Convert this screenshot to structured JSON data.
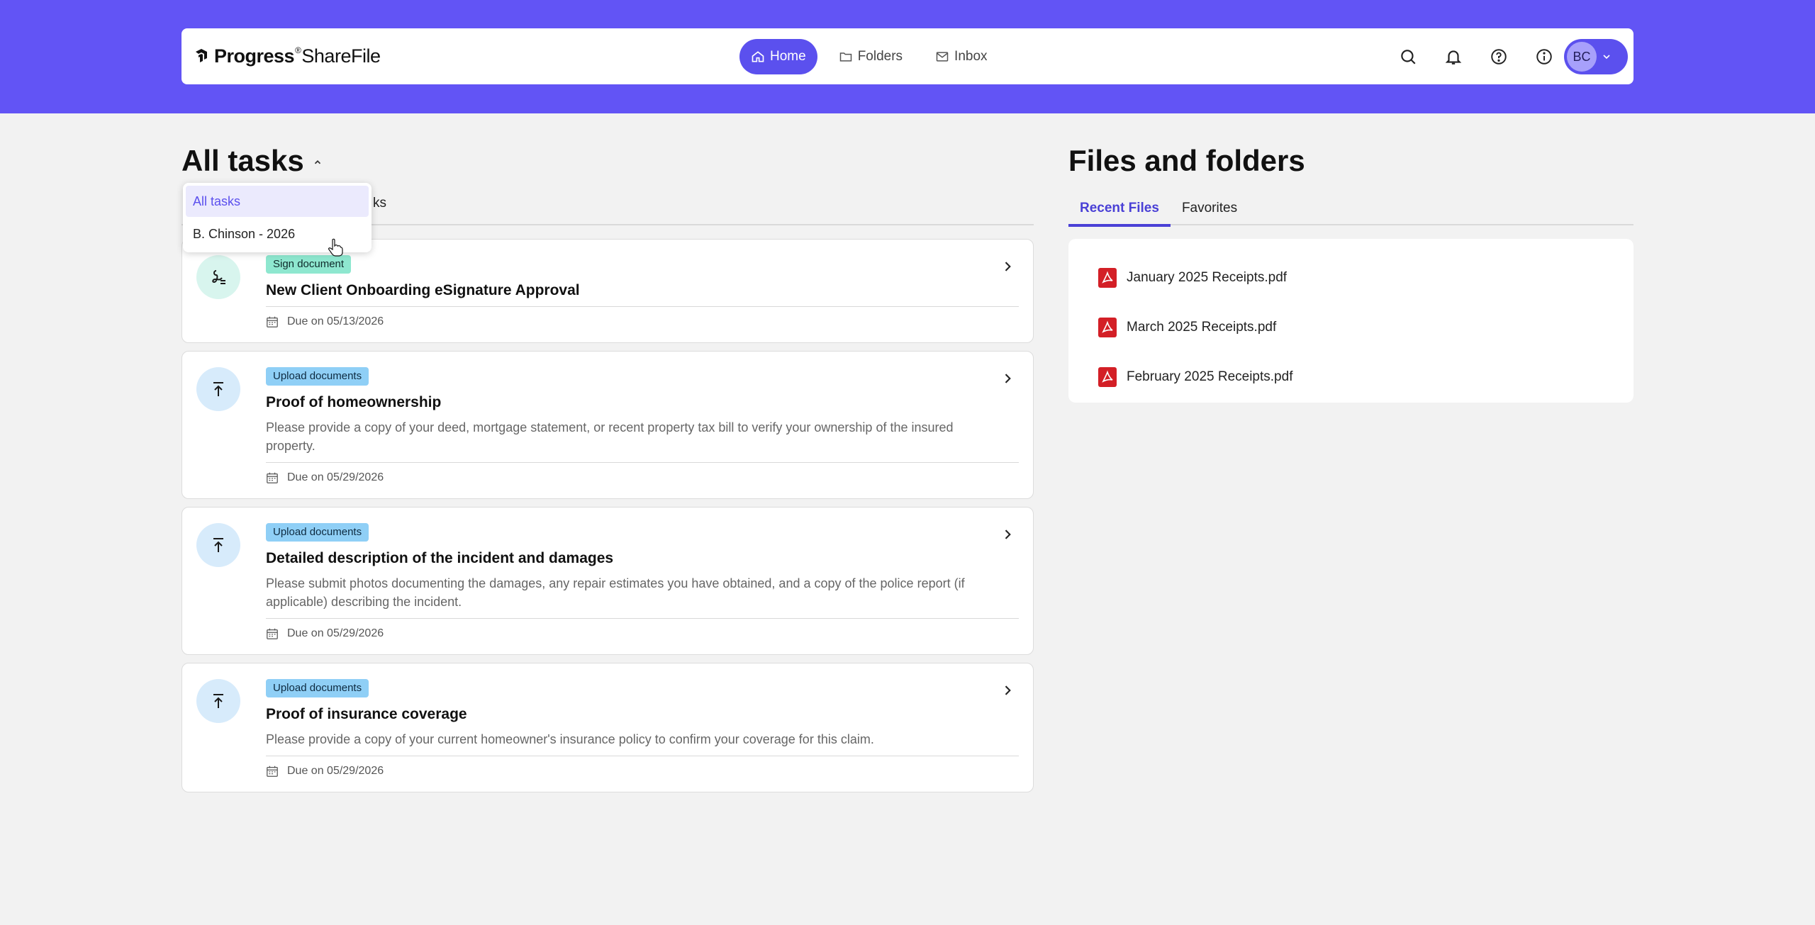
{
  "header": {
    "logo_text_a": "Progress",
    "logo_tm": "®",
    "logo_text_b": "ShareFile",
    "nav": [
      {
        "label": "Home",
        "icon": "home-icon",
        "active": true
      },
      {
        "label": "Folders",
        "icon": "folder-icon",
        "active": false
      },
      {
        "label": "Inbox",
        "icon": "mail-icon",
        "active": false
      }
    ],
    "icons": [
      "search-icon",
      "bell-icon",
      "help-icon",
      "info-icon"
    ],
    "avatar_initials": "BC"
  },
  "tasks": {
    "title": "All tasks",
    "tab_peek": "ks",
    "dropdown": [
      {
        "label": "All tasks",
        "selected": true
      },
      {
        "label": "B. Chinson - 2026",
        "selected": false
      }
    ],
    "items": [
      {
        "type": "sign",
        "badge": "Sign document",
        "title": "New Client Onboarding eSignature Approval",
        "desc": "",
        "due": "Due on 05/13/2026"
      },
      {
        "type": "upload",
        "badge": "Upload documents",
        "title": "Proof of homeownership",
        "desc": "Please provide a copy of your deed, mortgage statement, or recent property tax bill to verify your ownership of the insured property.",
        "due": "Due on 05/29/2026"
      },
      {
        "type": "upload",
        "badge": "Upload documents",
        "title": "Detailed description of the incident and damages",
        "desc": "Please submit photos documenting the damages, any repair estimates you have obtained, and a copy of the police report (if applicable) describing the incident.",
        "due": "Due on 05/29/2026"
      },
      {
        "type": "upload",
        "badge": "Upload documents",
        "title": "Proof of insurance coverage",
        "desc": "Please provide a copy of your current homeowner's insurance policy to confirm your coverage for this claim.",
        "due": "Due on 05/29/2026"
      }
    ]
  },
  "files": {
    "title": "Files and folders",
    "tabs": [
      {
        "label": "Recent Files",
        "active": true
      },
      {
        "label": "Favorites",
        "active": false
      }
    ],
    "items": [
      {
        "name": "January 2025 Receipts.pdf"
      },
      {
        "name": "March 2025 Receipts.pdf"
      },
      {
        "name": "February 2025 Receipts.pdf"
      }
    ]
  },
  "colors": {
    "brand": "#6254f5",
    "accent": "#5b50ee",
    "sign_badge": "#8ee7cf",
    "upload_badge": "#8fcff6",
    "pdf_red": "#d31f26"
  }
}
